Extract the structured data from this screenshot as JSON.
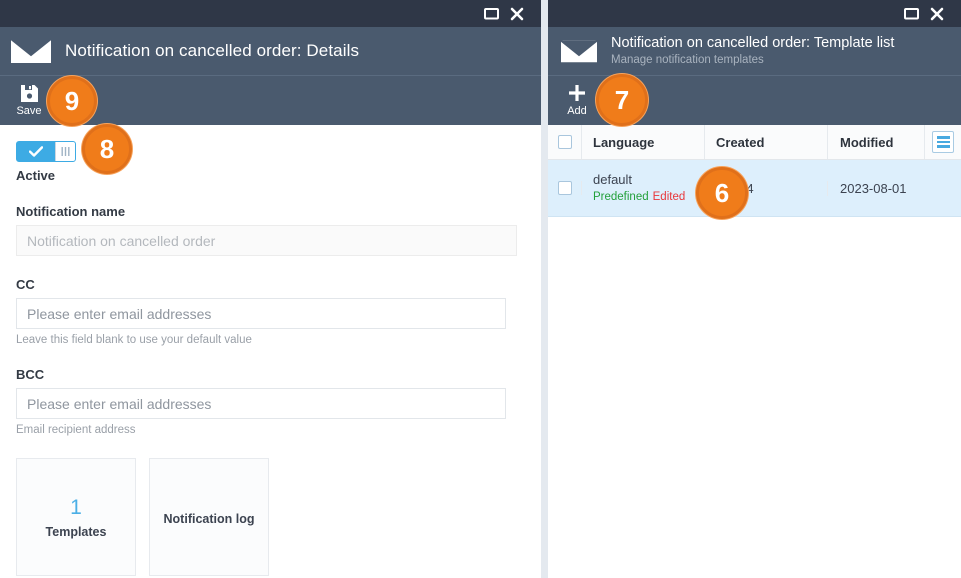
{
  "left_panel": {
    "window_controls": {
      "maximize": "maximize-icon",
      "close": "close-icon"
    },
    "header": {
      "icon": "envelope-icon",
      "title": "Notification on cancelled order: Details"
    },
    "toolbar": {
      "save": {
        "icon": "save-floppy-icon",
        "label": "Save"
      }
    },
    "form": {
      "active_toggle": {
        "label": "Active",
        "state": "on",
        "on_color": "#3dabe4"
      },
      "notification_name": {
        "label": "Notification name",
        "value": "",
        "placeholder": "Notification on cancelled order",
        "disabled": true
      },
      "cc": {
        "label": "CC",
        "value": "",
        "placeholder": "Please enter email addresses",
        "hint": "Leave this field blank to use your default value"
      },
      "bcc": {
        "label": "BCC",
        "value": "",
        "placeholder": "Please enter email addresses",
        "hint": "Email recipient address"
      },
      "tiles": [
        {
          "count": "1",
          "label": "Templates",
          "count_color": "#4bafe6"
        },
        {
          "count": "",
          "label": "Notification log"
        }
      ]
    }
  },
  "right_panel": {
    "window_controls": {
      "maximize": "maximize-icon",
      "close": "close-icon"
    },
    "header": {
      "icon": "envelope-icon",
      "title": "Notification on cancelled order: Template list",
      "subtitle": "Manage notification templates"
    },
    "toolbar": {
      "add": {
        "icon": "plus-icon",
        "label": "Add"
      }
    },
    "table": {
      "columns": [
        "Language",
        "Created",
        "Modified"
      ],
      "menu_icon": "hamburger-menu-icon",
      "rows": [
        {
          "selected": false,
          "language": "default",
          "tags": {
            "predefined": "Predefined",
            "edited": "Edited"
          },
          "created": "-09-24",
          "modified": "2023-08-01"
        }
      ]
    }
  },
  "step_badges": [
    {
      "id": "badge-9",
      "number": "9"
    },
    {
      "id": "badge-8",
      "number": "8"
    },
    {
      "id": "badge-7",
      "number": "7"
    },
    {
      "id": "badge-6",
      "number": "6"
    }
  ],
  "colors": {
    "titlebar": "#2f3747",
    "header": "#4a5a6e",
    "badge": "#f07c1a",
    "accent_blue": "#3dabe4",
    "row_selected": "#ddeffc",
    "tag_green": "#23a03b",
    "tag_red": "#e8373b"
  }
}
